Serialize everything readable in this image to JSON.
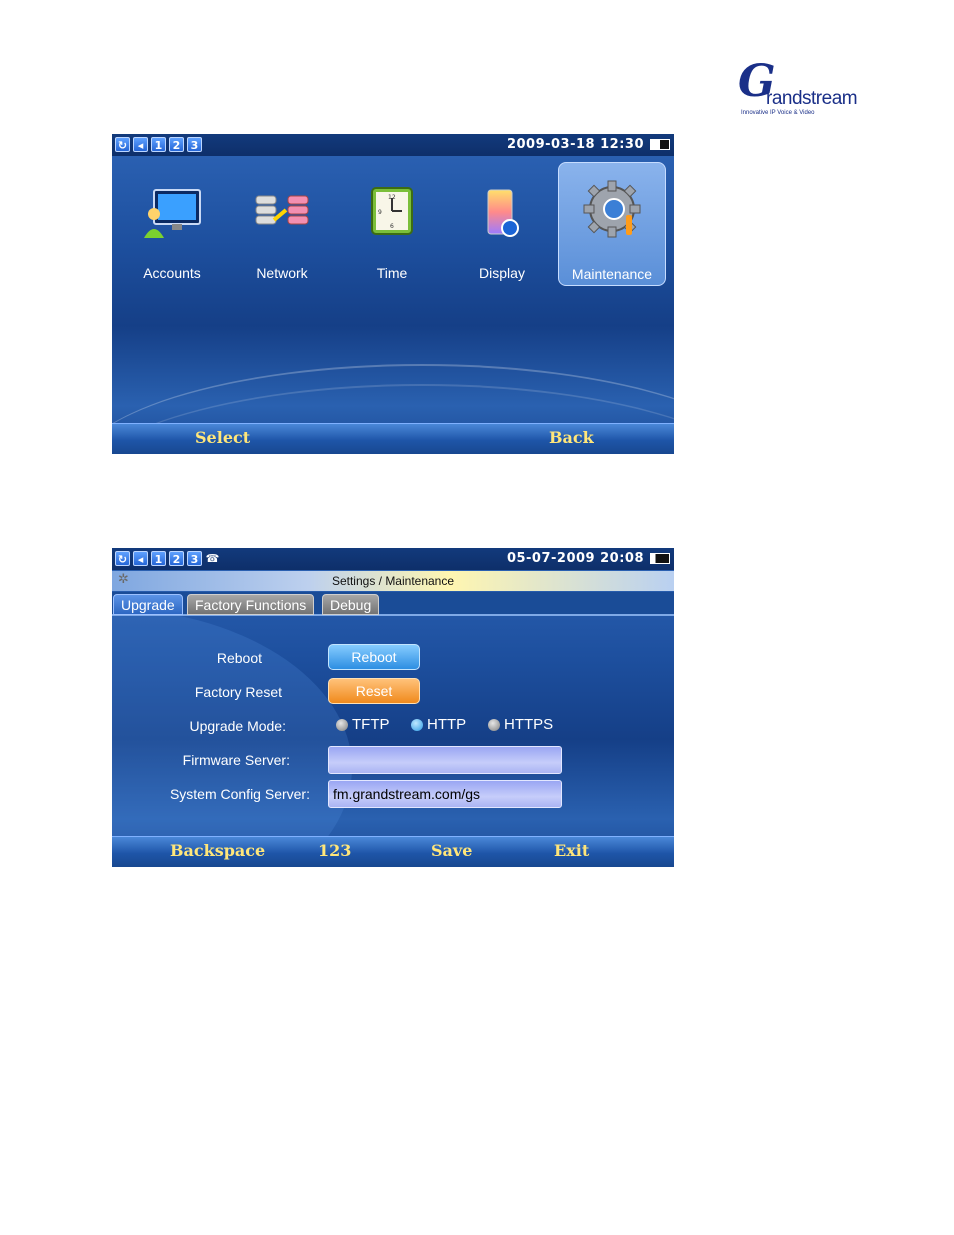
{
  "logo": {
    "mark": "G",
    "wordmark": "randstream",
    "tagline": "Innovative IP Voice & Video"
  },
  "screen1": {
    "status": {
      "icons": [
        "sync-icon",
        "volume-icon",
        "1",
        "2",
        "3"
      ],
      "datetime": "2009-03-18 12:30"
    },
    "menu": [
      {
        "label": "Accounts",
        "icon": "accounts-monitor-icon"
      },
      {
        "label": "Network",
        "icon": "network-icon"
      },
      {
        "label": "Time",
        "icon": "clock-icon"
      },
      {
        "label": "Display",
        "icon": "display-icon"
      },
      {
        "label": "Maintenance",
        "icon": "gear-tools-icon",
        "selected": true
      }
    ],
    "softkeys": {
      "left": "Select",
      "right": "Back"
    }
  },
  "screen2": {
    "status": {
      "icons": [
        "sync-icon",
        "volume-icon",
        "1",
        "2",
        "3",
        "phone-icon"
      ],
      "datetime": "05-07-2009 20:08"
    },
    "title": "Settings / Maintenance",
    "tabs": [
      {
        "label": "Upgrade",
        "active": true
      },
      {
        "label": "Factory Functions",
        "active": false
      },
      {
        "label": "Debug",
        "active": false
      }
    ],
    "form": {
      "reboot_label": "Reboot",
      "reboot_button": "Reboot",
      "factory_reset_label": "Factory Reset",
      "reset_button": "Reset",
      "upgrade_mode_label": "Upgrade Mode:",
      "upgrade_modes": [
        {
          "label": "TFTP",
          "selected": false
        },
        {
          "label": "HTTP",
          "selected": true
        },
        {
          "label": "HTTPS",
          "selected": false
        }
      ],
      "firmware_server_label": "Firmware Server:",
      "firmware_server_value": "",
      "config_server_label": "System Config Server:",
      "config_server_value": "fm.grandstream.com/gs"
    },
    "softkeys": [
      "Backspace",
      "123",
      "Save",
      "Exit"
    ]
  },
  "colors": {
    "accent": "#ffe67a",
    "screen_bg": "#1d4f9e",
    "logo": "#1a2f88",
    "reset": "#f08a1d",
    "reboot": "#2d8ee2"
  }
}
